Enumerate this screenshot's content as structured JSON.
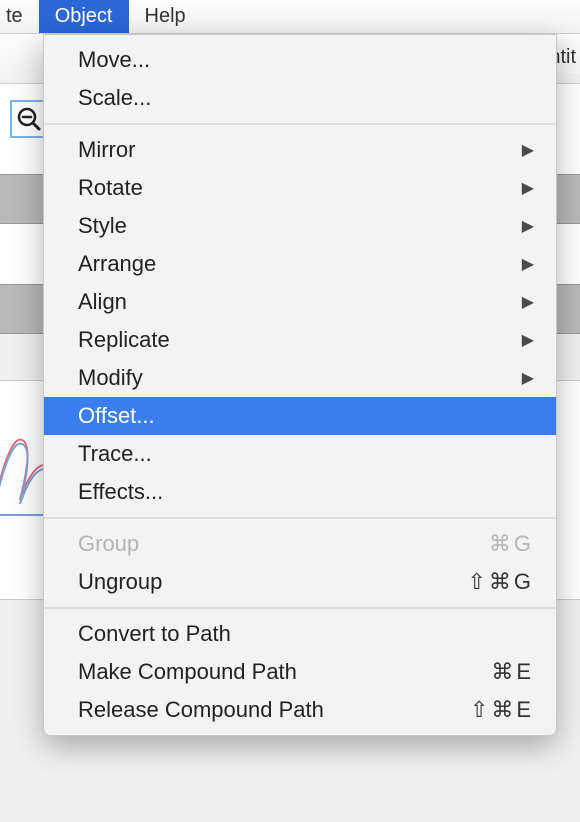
{
  "menubar": {
    "partial": "te",
    "object": "Object",
    "help": "Help"
  },
  "background": {
    "doc_label": "Untit"
  },
  "menu": {
    "move": "Move...",
    "scale": "Scale...",
    "mirror": "Mirror",
    "rotate": "Rotate",
    "style": "Style",
    "arrange": "Arrange",
    "align": "Align",
    "replicate": "Replicate",
    "modify": "Modify",
    "offset": "Offset...",
    "trace": "Trace...",
    "effects": "Effects...",
    "group": "Group",
    "group_shortcut": "⌘G",
    "ungroup": "Ungroup",
    "ungroup_shortcut": "⇧⌘G",
    "convert": "Convert to Path",
    "make_compound": "Make Compound Path",
    "make_compound_shortcut": "⌘E",
    "release_compound": "Release Compound Path",
    "release_compound_shortcut": "⇧⌘E"
  }
}
